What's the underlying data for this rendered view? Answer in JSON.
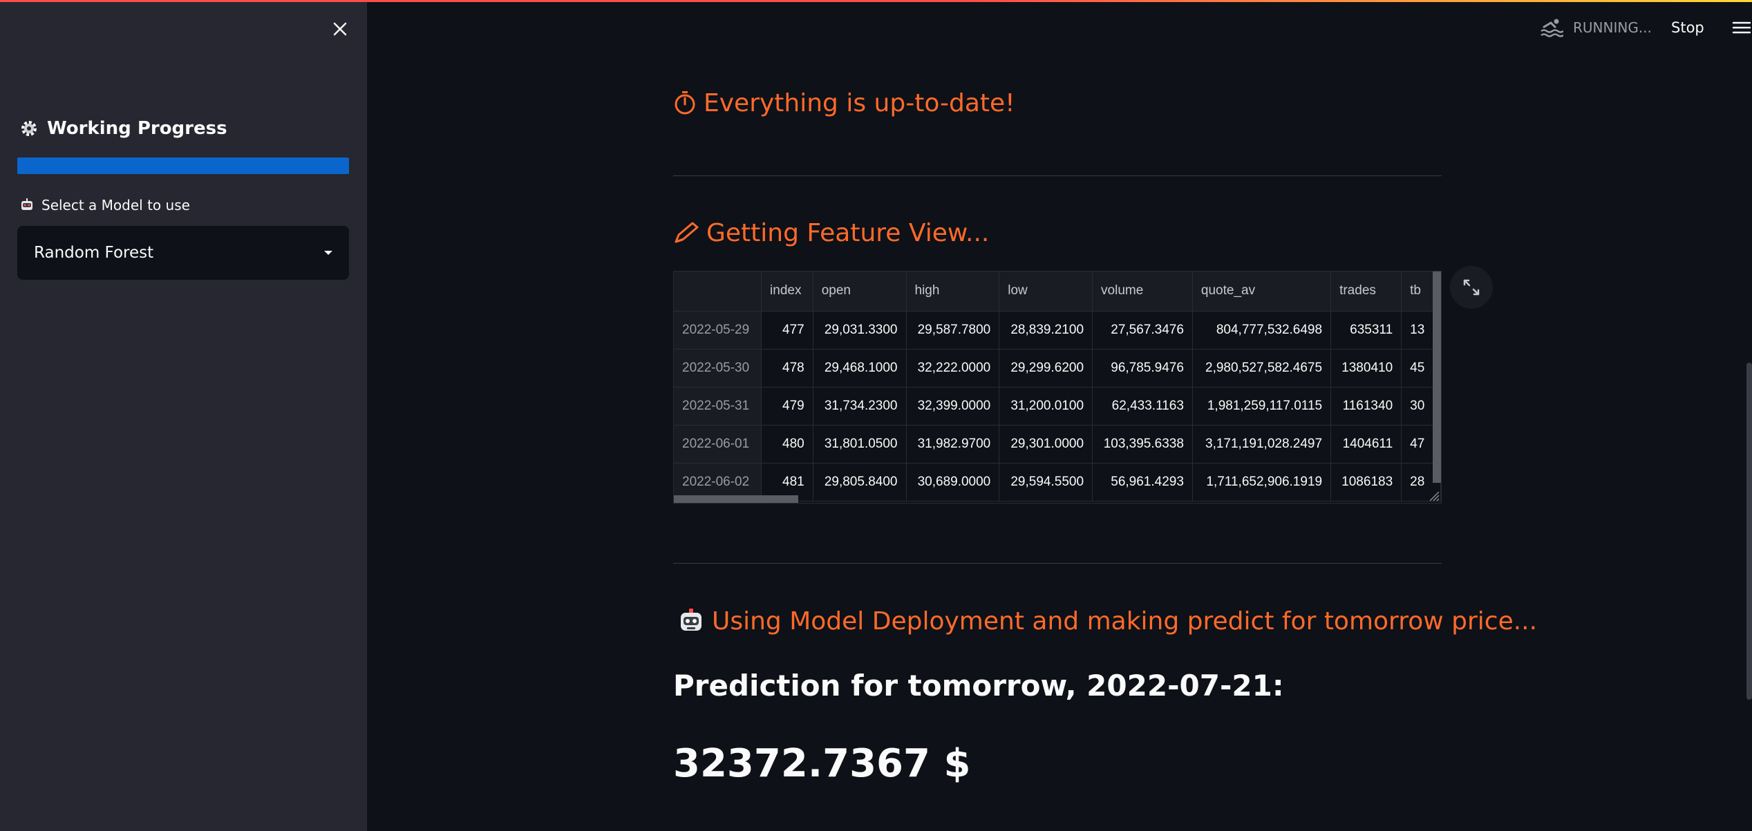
{
  "header": {
    "status_text": "RUNNING...",
    "stop_label": "Stop",
    "status_icon": "swimmer-icon",
    "menu_icon": "hamburger-menu-icon"
  },
  "sidebar": {
    "close_icon": "close-icon",
    "heading": "Working Progress",
    "heading_icon": "gear-icon",
    "progress": 1.0,
    "select_label": "Select a Model to use",
    "select_label_icon": "robot-icon",
    "select_value": "Random Forest"
  },
  "main": {
    "section1_title": "Everything is up-to-date!",
    "section1_icon": "stopwatch-icon",
    "section2_title": "Getting Feature View...",
    "section2_icon": "pencil-icon",
    "section3_title": "Using Model Deployment and making predict for tomorrow price...",
    "section3_icon": "robot-icon",
    "prediction_title": "Prediction for tomorrow, 2022-07-21:",
    "prediction_value": "32372.7367 $",
    "expand_icon": "expand-icon"
  },
  "table": {
    "columns": [
      "",
      "index",
      "open",
      "high",
      "low",
      "volume",
      "quote_av",
      "trades",
      "tb"
    ],
    "rows": [
      [
        "2022-05-29",
        "477",
        "29,031.3300",
        "29,587.7800",
        "28,839.2100",
        "27,567.3476",
        "804,777,532.6498",
        "635311",
        "13"
      ],
      [
        "2022-05-30",
        "478",
        "29,468.1000",
        "32,222.0000",
        "29,299.6200",
        "96,785.9476",
        "2,980,527,582.4675",
        "1380410",
        "45"
      ],
      [
        "2022-05-31",
        "479",
        "31,734.2300",
        "32,399.0000",
        "31,200.0100",
        "62,433.1163",
        "1,981,259,117.0115",
        "1161340",
        "30"
      ],
      [
        "2022-06-01",
        "480",
        "31,801.0500",
        "31,982.9700",
        "29,301.0000",
        "103,395.6338",
        "3,171,191,028.2497",
        "1404611",
        "47"
      ],
      [
        "2022-06-02",
        "481",
        "29,805.8400",
        "30,689.0000",
        "29,594.5500",
        "56,961.4293",
        "1,711,652,906.1919",
        "1086183",
        "28"
      ]
    ]
  },
  "colors": {
    "accent_orange": "#ff6a2b",
    "progress_blue": "#0a66cc",
    "sidebar_bg": "#262730",
    "main_bg": "#0e1117"
  }
}
